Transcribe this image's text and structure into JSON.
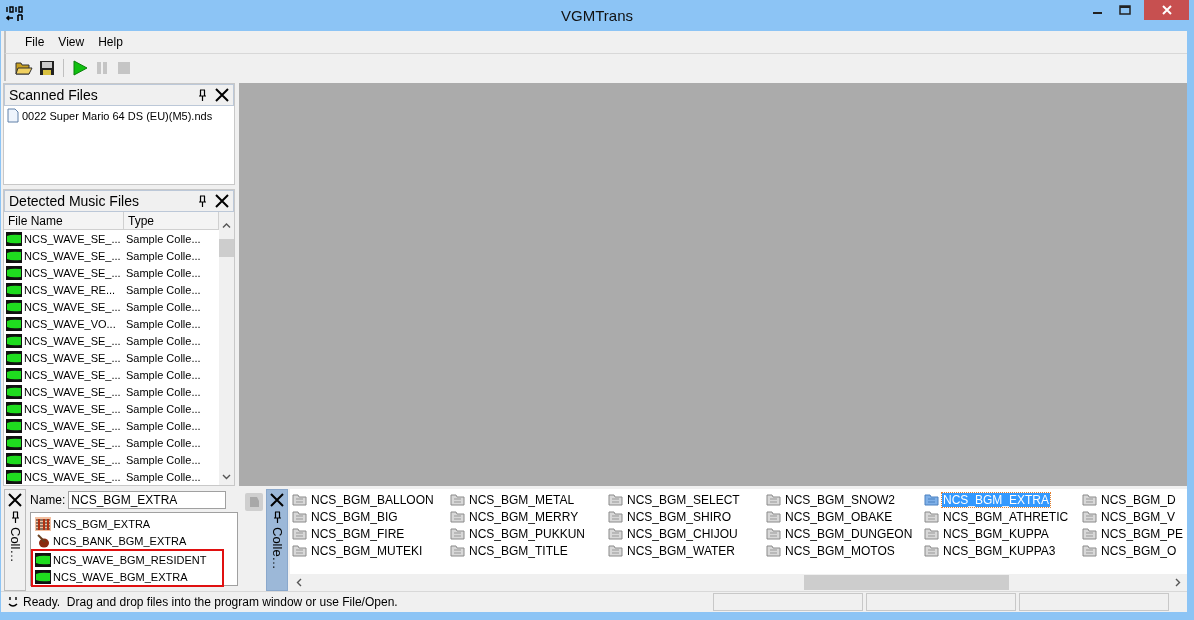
{
  "window": {
    "title": "VGMTrans"
  },
  "menu": [
    "File",
    "View",
    "Help"
  ],
  "toolbar": [
    {
      "kind": "open",
      "disabled": false
    },
    {
      "kind": "save",
      "disabled": false
    },
    {
      "kind": "play",
      "disabled": false
    },
    {
      "kind": "pause",
      "disabled": true
    },
    {
      "kind": "stop",
      "disabled": true
    }
  ],
  "scanned_files": {
    "title": "Scanned Files",
    "items": [
      "0022 Super Mario 64 DS (EU)(M5).nds"
    ]
  },
  "detected": {
    "title": "Detected Music Files",
    "columns": [
      "File Name",
      "Type"
    ],
    "rows": [
      {
        "name": "NCS_WAVE_SE_...",
        "type": "Sample Colle..."
      },
      {
        "name": "NCS_WAVE_SE_...",
        "type": "Sample Colle..."
      },
      {
        "name": "NCS_WAVE_SE_...",
        "type": "Sample Colle..."
      },
      {
        "name": "NCS_WAVE_RE...",
        "type": "Sample Colle..."
      },
      {
        "name": "NCS_WAVE_SE_...",
        "type": "Sample Colle..."
      },
      {
        "name": "NCS_WAVE_VO...",
        "type": "Sample Colle..."
      },
      {
        "name": "NCS_WAVE_SE_...",
        "type": "Sample Colle..."
      },
      {
        "name": "NCS_WAVE_SE_...",
        "type": "Sample Colle..."
      },
      {
        "name": "NCS_WAVE_SE_...",
        "type": "Sample Colle..."
      },
      {
        "name": "NCS_WAVE_SE_...",
        "type": "Sample Colle..."
      },
      {
        "name": "NCS_WAVE_SE_...",
        "type": "Sample Colle..."
      },
      {
        "name": "NCS_WAVE_SE_...",
        "type": "Sample Colle..."
      },
      {
        "name": "NCS_WAVE_SE_...",
        "type": "Sample Colle..."
      },
      {
        "name": "NCS_WAVE_SE_...",
        "type": "Sample Colle..."
      },
      {
        "name": "NCS_WAVE_SE_...",
        "type": "Sample Colle..."
      }
    ]
  },
  "collection": {
    "tab": "Coll…",
    "name_label": "Name:",
    "name_value": "NCS_BGM_EXTRA",
    "items": [
      {
        "kind": "seq",
        "label": "NCS_BGM_EXTRA",
        "marked": false
      },
      {
        "kind": "bank",
        "label": "NCS_BANK_BGM_EXTRA",
        "marked": false
      },
      {
        "kind": "wave",
        "label": "NCS_WAVE_BGM_RESIDENT",
        "marked": true
      },
      {
        "kind": "wave",
        "label": "NCS_WAVE_BGM_EXTRA",
        "marked": true
      }
    ]
  },
  "collections": {
    "tab": "Colle…",
    "items": [
      {
        "label": "NCS_BGM_BALLOON",
        "selected": false
      },
      {
        "label": "NCS_BGM_BIG",
        "selected": false
      },
      {
        "label": "NCS_BGM_FIRE",
        "selected": false
      },
      {
        "label": "NCS_BGM_MUTEKI",
        "selected": false
      },
      {
        "label": "NCS_BGM_METAL",
        "selected": false
      },
      {
        "label": "NCS_BGM_MERRY",
        "selected": false
      },
      {
        "label": "NCS_BGM_PUKKUN",
        "selected": false
      },
      {
        "label": "NCS_BGM_TITLE",
        "selected": false
      },
      {
        "label": "NCS_BGM_SELECT",
        "selected": false
      },
      {
        "label": "NCS_BGM_SHIRO",
        "selected": false
      },
      {
        "label": "NCS_BGM_CHIJOU",
        "selected": false
      },
      {
        "label": "NCS_BGM_WATER",
        "selected": false
      },
      {
        "label": "NCS_BGM_SNOW2",
        "selected": false
      },
      {
        "label": "NCS_BGM_OBAKE",
        "selected": false
      },
      {
        "label": "NCS_BGM_DUNGEON",
        "selected": false
      },
      {
        "label": "NCS_BGM_MOTOS",
        "selected": false
      },
      {
        "label": "NCS_BGM_EXTRA",
        "selected": true
      },
      {
        "label": "NCS_BGM_ATHRETIC",
        "selected": false
      },
      {
        "label": "NCS_BGM_KUPPA",
        "selected": false
      },
      {
        "label": "NCS_BGM_KUPPA3",
        "selected": false
      },
      {
        "label": "NCS_BGM_D",
        "selected": false
      },
      {
        "label": "NCS_BGM_V",
        "selected": false
      },
      {
        "label": "NCS_BGM_PE",
        "selected": false
      },
      {
        "label": "NCS_BGM_O",
        "selected": false
      }
    ]
  },
  "status_bar": {
    "text": "Ready.  Drag and drop files into the program window or use File/Open."
  }
}
